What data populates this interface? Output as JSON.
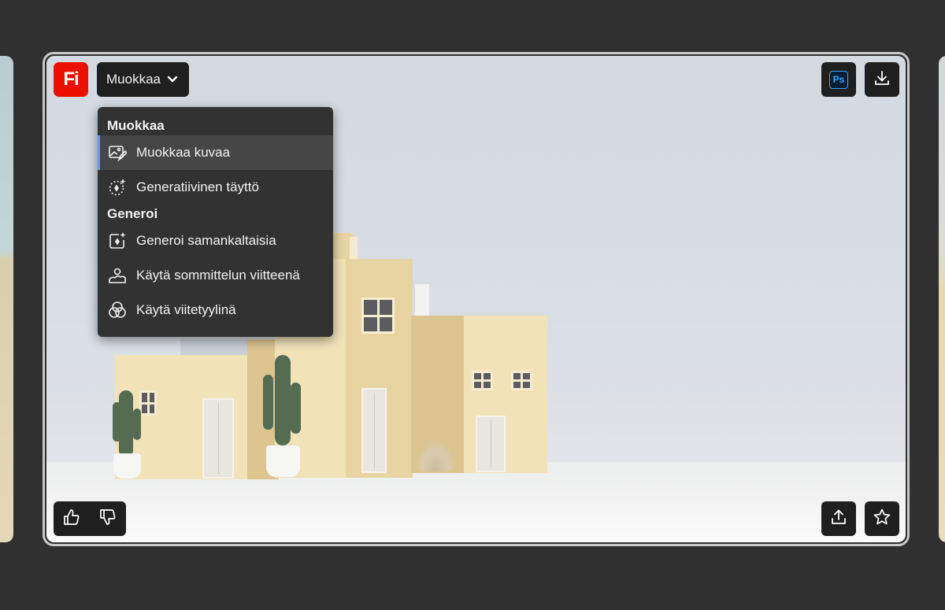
{
  "app": {
    "logo_text": "Fi",
    "brand_color": "#eb1000"
  },
  "toolbar": {
    "edit_dropdown_label": "Muokkaa",
    "photoshop_label": "Ps",
    "photoshop_color": "#31a8ff"
  },
  "menu": {
    "sections": [
      {
        "title": "Muokkaa",
        "items": [
          {
            "label": "Muokkaa kuvaa",
            "icon": "edit-image-icon",
            "active": true
          },
          {
            "label": "Generatiivinen täyttö",
            "icon": "generative-fill-icon",
            "active": false
          }
        ]
      },
      {
        "title": "Generoi",
        "items": [
          {
            "label": "Generoi samankaltaisia",
            "icon": "generate-similar-icon",
            "active": false
          },
          {
            "label": "Käytä sommittelun viitteenä",
            "icon": "composition-reference-icon",
            "active": false
          },
          {
            "label": "Käytä viitetyylinä",
            "icon": "style-reference-icon",
            "active": false
          }
        ]
      }
    ],
    "accent_color": "#6a9bf0"
  },
  "actions": {
    "download_icon": "download-icon",
    "share_icon": "share-icon",
    "favorite_icon": "star-icon",
    "like_icon": "thumbs-up-icon",
    "dislike_icon": "thumbs-down-icon"
  }
}
